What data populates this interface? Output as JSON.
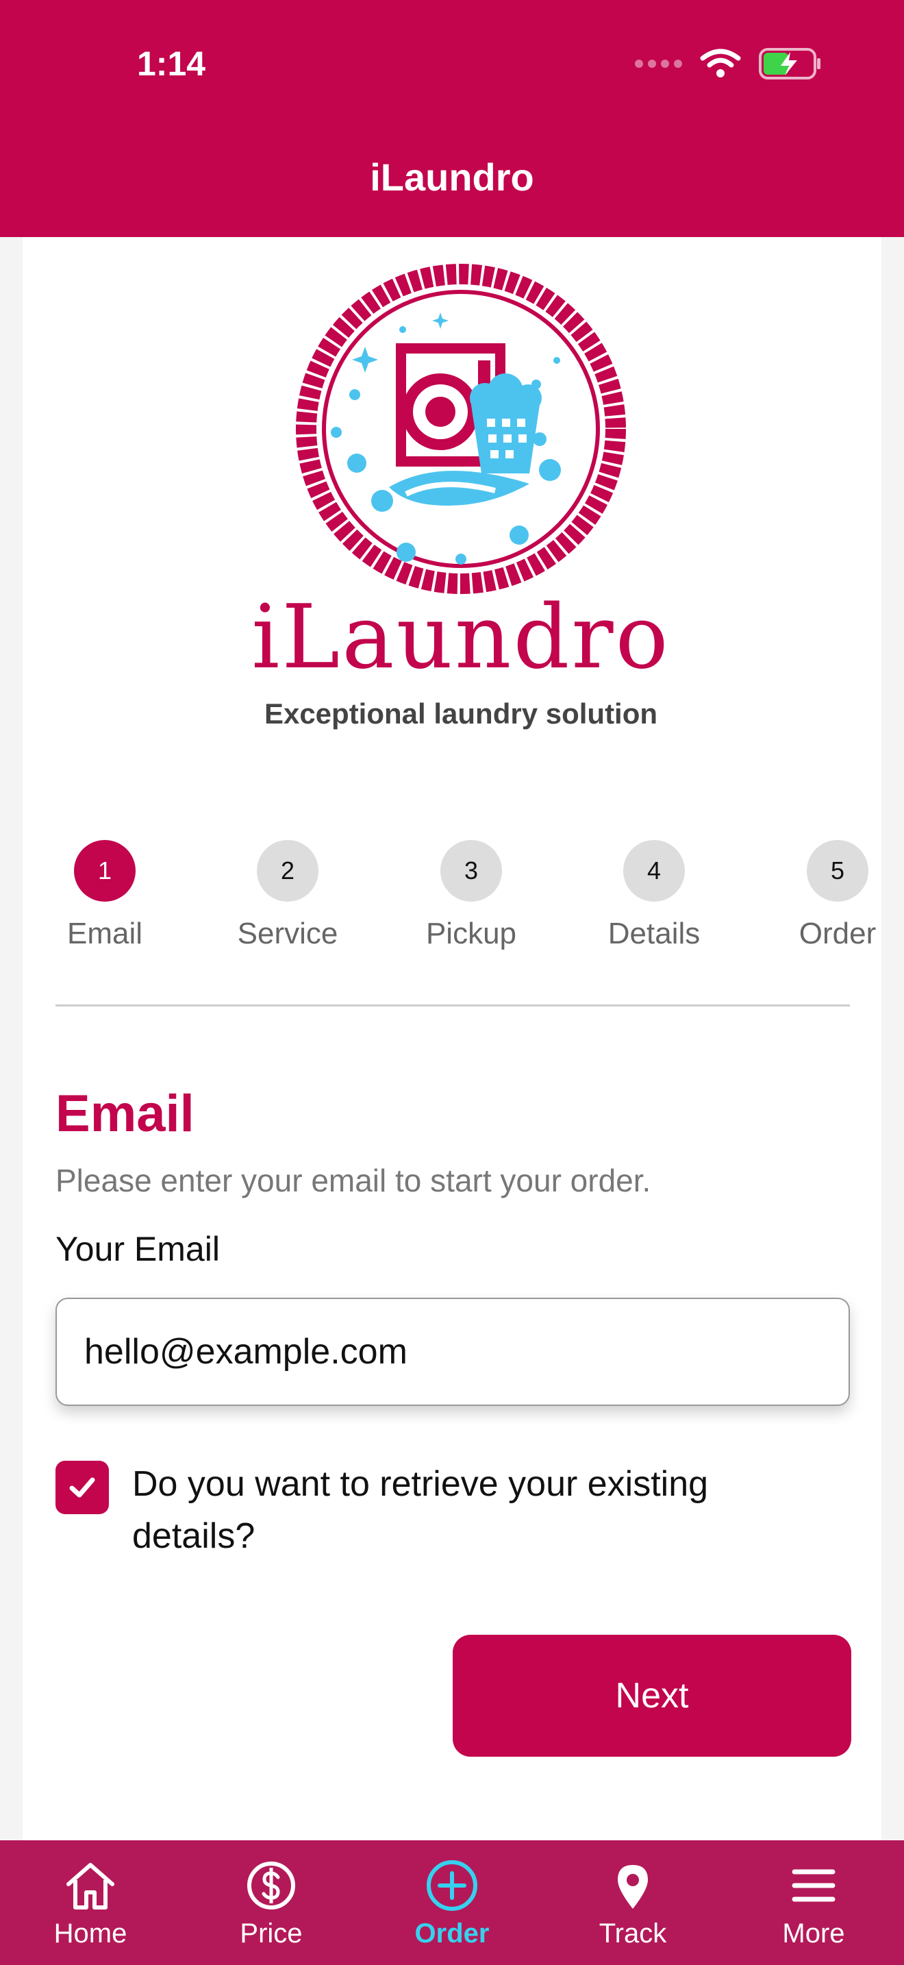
{
  "status_bar": {
    "time": "1:14"
  },
  "header": {
    "title": "iLaundro"
  },
  "logo": {
    "name": "iLaundro",
    "tagline": "Exceptional laundry solution"
  },
  "stepper": {
    "steps": [
      {
        "number": "1",
        "label": "Email",
        "active": true
      },
      {
        "number": "2",
        "label": "Service",
        "active": false
      },
      {
        "number": "3",
        "label": "Pickup",
        "active": false
      },
      {
        "number": "4",
        "label": "Details",
        "active": false
      },
      {
        "number": "5",
        "label": "Order",
        "active": false
      }
    ]
  },
  "form": {
    "title": "Email",
    "subtitle": "Please enter your email to start your order.",
    "email_label": "Your Email",
    "email_value": "hello@example.com",
    "retrieve_checked": true,
    "retrieve_label": "Do you want to retrieve your existing details?",
    "next_label": "Next"
  },
  "tabbar": {
    "items": [
      {
        "label": "Home",
        "icon": "home-icon",
        "active": false
      },
      {
        "label": "Price",
        "icon": "dollar-icon",
        "active": false
      },
      {
        "label": "Order",
        "icon": "plus-circle-icon",
        "active": true
      },
      {
        "label": "Track",
        "icon": "location-pin-icon",
        "active": false
      },
      {
        "label": "More",
        "icon": "menu-icon",
        "active": false
      }
    ]
  },
  "colors": {
    "brand": "#c2054d",
    "tabbar": "#b31958",
    "active_tab": "#35d1ef",
    "logo_blue": "#4cc3ee"
  }
}
